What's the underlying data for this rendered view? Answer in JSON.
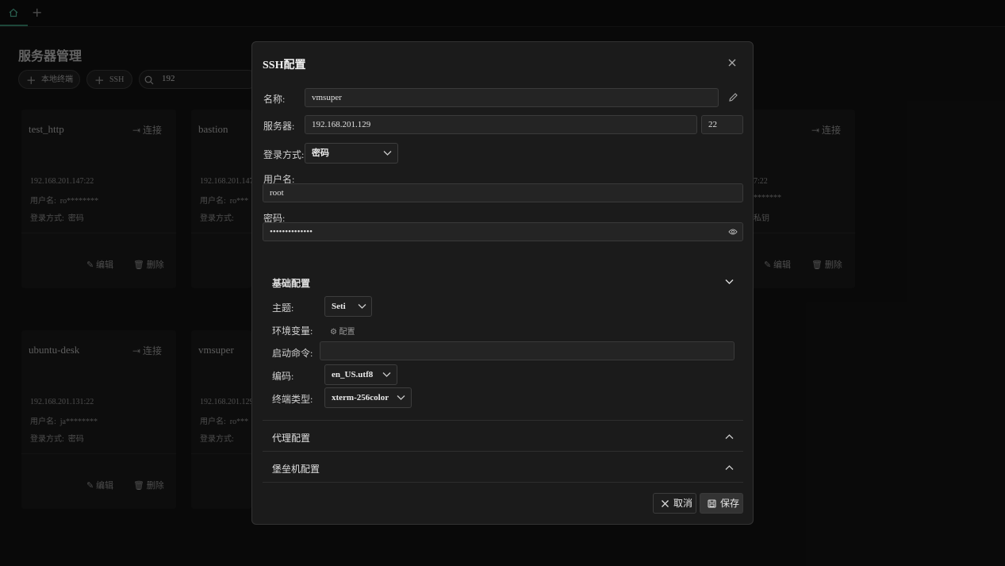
{
  "tabs": {
    "add_label": "+"
  },
  "page": {
    "title": "服务器管理",
    "buttons": {
      "local_terminal": "本地终端",
      "ssh": "SSH"
    },
    "search": {
      "value": "192"
    }
  },
  "cards": [
    {
      "name": "test_http",
      "connect": "连接",
      "address": "192.168.201.147:22",
      "user_label": "用户名:",
      "user": "ro********",
      "login_label": "登录方式:",
      "login": "密码",
      "edit": "编辑",
      "delete": "删除"
    },
    {
      "name": "bastion",
      "connect": "",
      "address": "192.168.201.147:",
      "user_label": "用户名:",
      "user": "ro***",
      "login_label": "登录方式:",
      "login": "",
      "edit": "",
      "delete": ""
    },
    {
      "name": "",
      "connect": "连接",
      "address": "7:22",
      "user_label": "",
      "user": "*******",
      "login_label": "",
      "login": "私钥",
      "edit": "编辑",
      "delete": "删除"
    },
    {
      "name": "ubuntu-desk",
      "connect": "连接",
      "address": "192.168.201.131:22",
      "user_label": "用户名:",
      "user": "ja********",
      "login_label": "登录方式:",
      "login": "密码",
      "edit": "编辑",
      "delete": "删除"
    },
    {
      "name": "vmsuper",
      "connect": "",
      "address": "192.168.201.129:",
      "user_label": "用户名:",
      "user": "ro***",
      "login_label": "登录方式:",
      "login": "",
      "edit": "",
      "delete": ""
    }
  ],
  "modal": {
    "title": "SSH配置",
    "name_label": "名称:",
    "name_value": "vmsuper",
    "server_label": "服务器:",
    "host_value": "192.168.201.129",
    "port_value": "22",
    "login_method_label": "登录方式:",
    "login_method_value": "密码",
    "username_label": "用户名:",
    "username_value": "root",
    "password_label": "密码:",
    "password_value": "••••••••••••••",
    "basic": {
      "title": "基础配置",
      "theme_label": "主题:",
      "theme_value": "Seti",
      "env_label": "环境变量:",
      "env_button": "配置",
      "startup_label": "启动命令:",
      "startup_value": "",
      "encoding_label": "编码:",
      "encoding_value": "en_US.utf8",
      "term_label": "终端类型:",
      "term_value": "xterm-256color"
    },
    "proxy_title": "代理配置",
    "bastion_title": "堡垒机配置",
    "cancel": "取消",
    "save": "保存"
  },
  "colors": {
    "accent": "#2d6e5a",
    "bg": "#0f0f0f",
    "modal_bg": "#1b1b1b"
  }
}
